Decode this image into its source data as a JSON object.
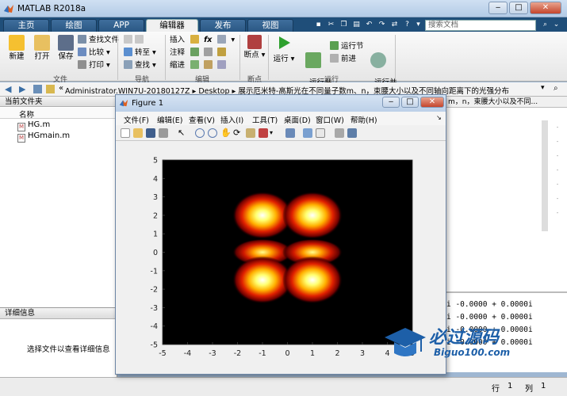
{
  "window": {
    "title": "MATLAB R2018a"
  },
  "tabs": [
    "主页",
    "绘图",
    "APP",
    "编辑器",
    "发布",
    "视图"
  ],
  "active_tab": "编辑器",
  "search": {
    "placeholder": "搜索文档"
  },
  "ribbon": {
    "file_group": {
      "label": "文件",
      "new": "新建",
      "open": "打开",
      "save": "保存",
      "find_files": "查找文件",
      "compare": "比较",
      "print": "打印"
    },
    "navigate_group": {
      "label": "导航",
      "goto": "转至",
      "find": "查找"
    },
    "edit_group": {
      "label": "编辑",
      "insert": "插入",
      "comment": "注释",
      "indent": "缩进",
      "fx": "fx"
    },
    "breakpoint_group": {
      "label": "断点",
      "breakpoints": "断点"
    },
    "run_group": {
      "label": "运行",
      "run": "运行",
      "run_advance": "运行并\n前进",
      "run_section": "运行节",
      "advance": "前进",
      "run_time": "运行并\n计时"
    }
  },
  "address": {
    "segments": [
      "Administrator.WIN7U-20180127Z",
      "Desktop",
      "展示厄米特-高斯光在不同量子数m、n，束腰大小以及不同轴向距离下的光强分布"
    ]
  },
  "left_panel": {
    "header": "当前文件夹",
    "column": "名称",
    "files": [
      "HG.m",
      "HGmain.m"
    ],
    "details_header": "详细信息",
    "details_text": "选择文件以查看详细信息"
  },
  "right_panel": {
    "header_text": "m，n，束腰大小以及不同...",
    "command_lines": [
      "i  -0.0000 + 0.0000i",
      "i  -0.0000 + 0.0000i",
      "i  -0.0000 + 0.0000i",
      "i  -0.0000 + 0.0000i"
    ]
  },
  "status": {
    "row_label": "行",
    "row": "1",
    "col_label": "列",
    "col": "1"
  },
  "figure": {
    "title": "Figure 1",
    "menu": [
      "文件(F)",
      "编辑(E)",
      "查看(V)",
      "插入(I)",
      "工具(T)",
      "桌面(D)",
      "窗口(W)",
      "帮助(H)"
    ]
  },
  "chart_data": {
    "type": "heatmap",
    "title": "",
    "xlabel": "",
    "ylabel": "",
    "xlim": [
      -5,
      5
    ],
    "ylim": [
      -5,
      5
    ],
    "x_ticks": [
      -5,
      -4,
      -3,
      -2,
      -1,
      0,
      1,
      2,
      3,
      4,
      5
    ],
    "y_ticks": [
      -5,
      -4,
      -3,
      -2,
      -1,
      0,
      1,
      2,
      3,
      4,
      5
    ],
    "colormap": "hot",
    "lobes": [
      {
        "x": -1,
        "y": 2,
        "intensity": 1.0
      },
      {
        "x": 1,
        "y": 2,
        "intensity": 1.0
      },
      {
        "x": -1,
        "y": 0,
        "intensity": 0.55
      },
      {
        "x": 1,
        "y": 0,
        "intensity": 0.55
      },
      {
        "x": -1,
        "y": -1.5,
        "intensity": 1.0
      },
      {
        "x": 1,
        "y": -1.5,
        "intensity": 1.0
      }
    ],
    "grid": false
  },
  "logo": {
    "brand": "必过源码",
    "url": "Biguo100.com"
  },
  "colors": {
    "tab_bar": "#1f4e79",
    "plot_bg": "#000000",
    "figure_bg": "#f0f0f0"
  }
}
